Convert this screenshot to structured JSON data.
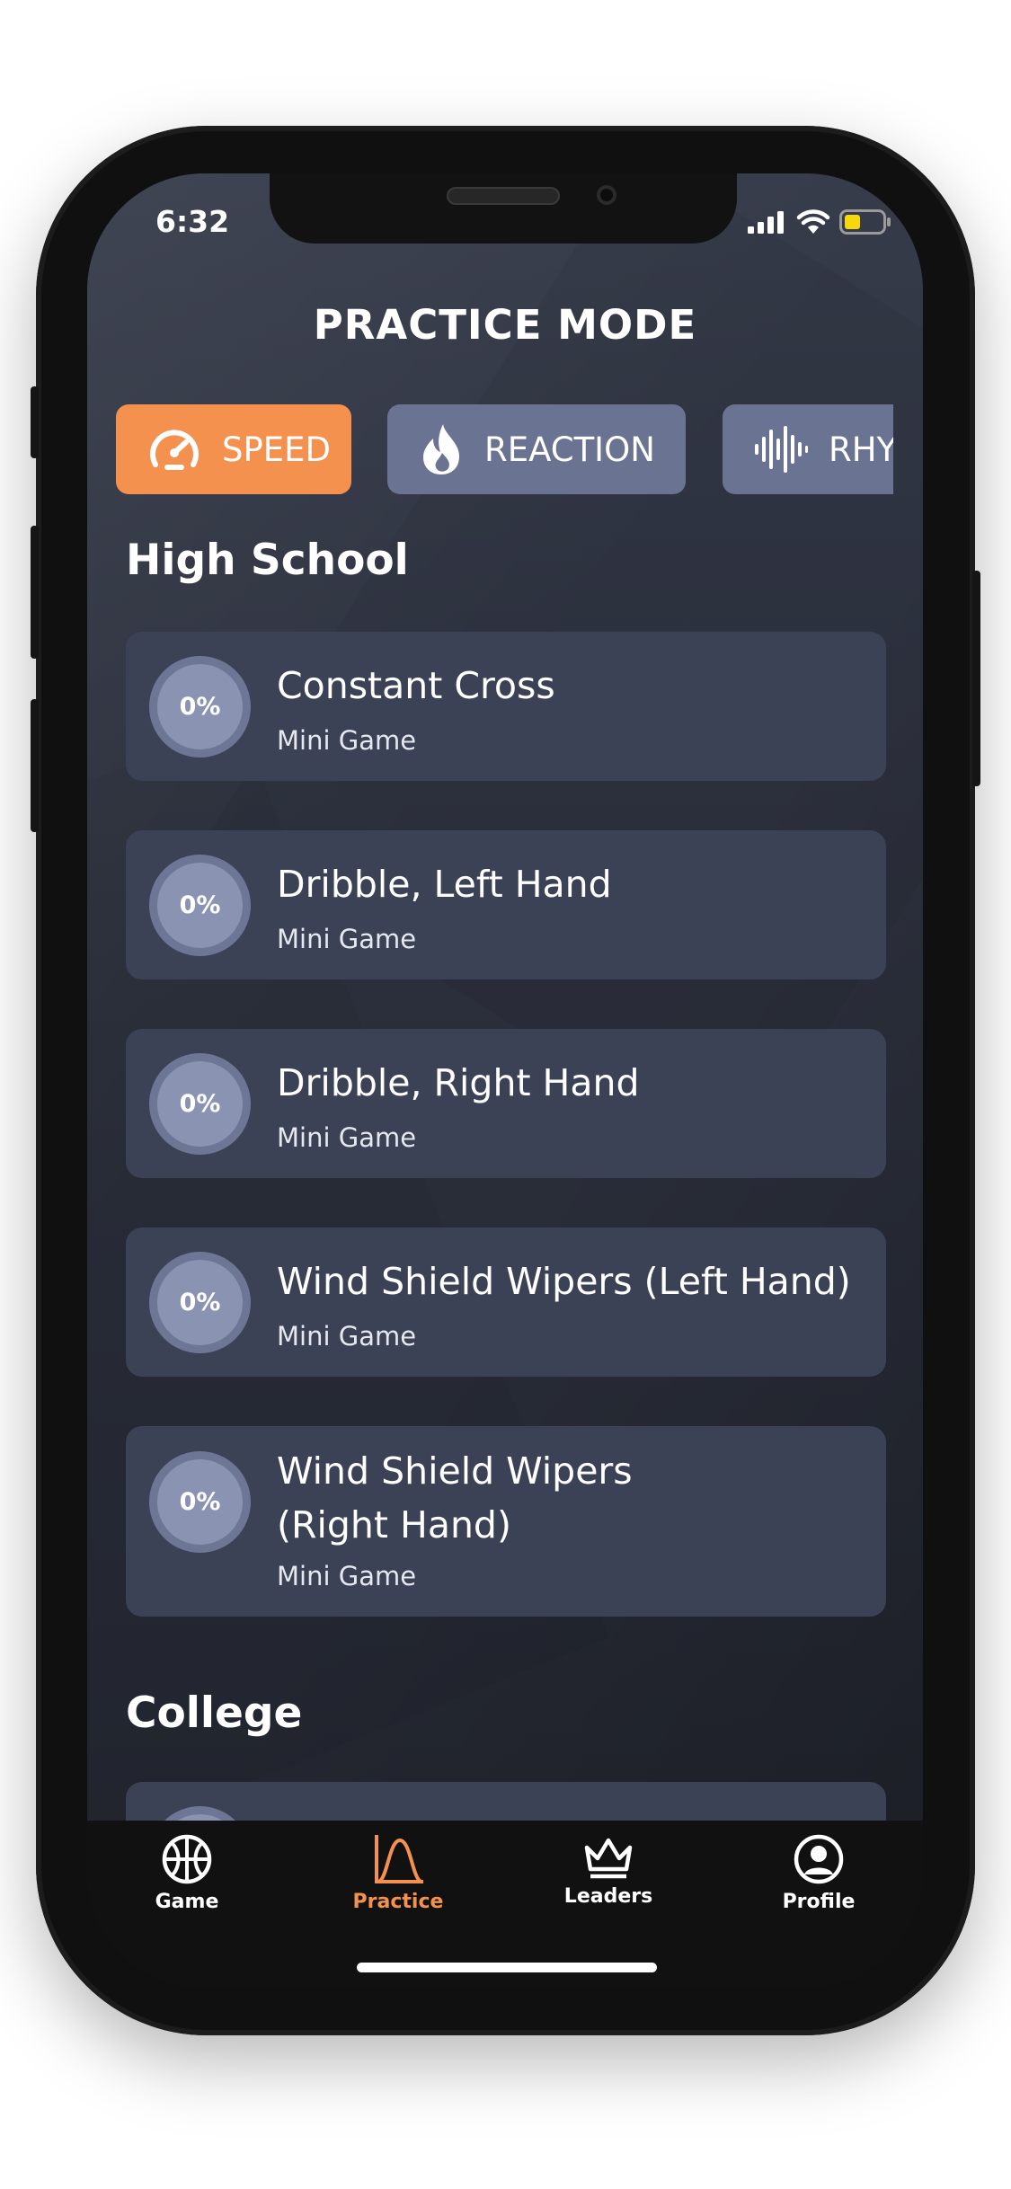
{
  "status_bar": {
    "time": "6:32"
  },
  "header": {
    "title": "PRACTICE MODE"
  },
  "category_tabs": [
    {
      "label": "SPEED",
      "icon": "speedometer-icon",
      "active": true
    },
    {
      "label": "REACTION",
      "icon": "flame-icon",
      "active": false
    },
    {
      "label": "RHYT",
      "icon": "sound-wave-icon",
      "active": false
    }
  ],
  "sections": [
    {
      "title": "High School",
      "items": [
        {
          "progress": "0%",
          "title": "Constant Cross",
          "subtitle": "Mini Game"
        },
        {
          "progress": "0%",
          "title": "Dribble, Left Hand",
          "subtitle": "Mini Game"
        },
        {
          "progress": "0%",
          "title": "Dribble, Right Hand",
          "subtitle": "Mini Game"
        },
        {
          "progress": "0%",
          "title": "Wind Shield Wipers (Left Hand)",
          "subtitle": "Mini Game"
        },
        {
          "progress": "0%",
          "title_line1": "Wind Shield Wipers",
          "title_line2": "(Right Hand)",
          "subtitle": "Mini Game"
        }
      ]
    },
    {
      "title": "College",
      "items": []
    }
  ],
  "tab_bar": {
    "items": [
      {
        "label": "Game",
        "icon": "basketball-icon",
        "active": false
      },
      {
        "label": "Practice",
        "icon": "practice-curve-icon",
        "active": true
      },
      {
        "label": "Leaders",
        "icon": "crown-icon",
        "active": false
      },
      {
        "label": "Profile",
        "icon": "profile-icon",
        "active": false
      }
    ]
  },
  "colors": {
    "accent": "#f4914e",
    "tab_inactive": "#6b7392",
    "card": "#3c4255",
    "background": "#2b2f3b",
    "tab_bar": "#111111"
  }
}
